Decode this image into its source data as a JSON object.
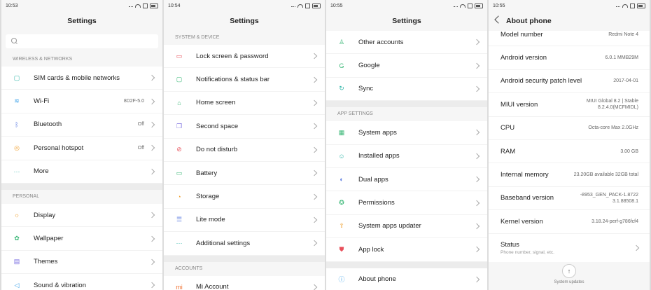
{
  "panel1": {
    "time": "10:53",
    "title": "Settings",
    "sections": [
      {
        "header": "WIRELESS & NETWORKS",
        "items": [
          {
            "label": "SIM cards & mobile networks",
            "value": "",
            "icon": "sim-icon",
            "glyph": "▢",
            "color": "#2fb5a8"
          },
          {
            "label": "Wi-Fi",
            "value": "8D2F-5.0",
            "icon": "wifi-icon",
            "glyph": "≋",
            "color": "#3aa0e8"
          },
          {
            "label": "Bluetooth",
            "value": "Off",
            "icon": "bluetooth-icon",
            "glyph": "ᛒ",
            "color": "#5b7be0"
          },
          {
            "label": "Personal hotspot",
            "value": "Off",
            "icon": "hotspot-icon",
            "glyph": "◎",
            "color": "#f0a030"
          },
          {
            "label": "More",
            "value": "",
            "icon": "more-icon",
            "glyph": "···",
            "color": "#2fb5a8"
          }
        ]
      },
      {
        "header": "PERSONAL",
        "items": [
          {
            "label": "Display",
            "value": "",
            "icon": "display-icon",
            "glyph": "☼",
            "color": "#f0a030"
          },
          {
            "label": "Wallpaper",
            "value": "",
            "icon": "wallpaper-icon",
            "glyph": "✿",
            "color": "#3cb878"
          },
          {
            "label": "Themes",
            "value": "",
            "icon": "themes-icon",
            "glyph": "▤",
            "color": "#7a6ee0"
          },
          {
            "label": "Sound & vibration",
            "value": "",
            "icon": "sound-icon",
            "glyph": "◁",
            "color": "#3aa0e8"
          }
        ]
      }
    ]
  },
  "panel2": {
    "time": "10:54",
    "title": "Settings",
    "sections": [
      {
        "header": "SYSTEM & DEVICE",
        "items": [
          {
            "label": "Lock screen & password",
            "value": "",
            "icon": "lock-icon",
            "glyph": "▭",
            "color": "#e8505b"
          },
          {
            "label": "Notifications & status bar",
            "value": "",
            "icon": "notifications-icon",
            "glyph": "▢",
            "color": "#3cb878"
          },
          {
            "label": "Home screen",
            "value": "",
            "icon": "home-icon",
            "glyph": "⌂",
            "color": "#3cb878"
          },
          {
            "label": "Second space",
            "value": "",
            "icon": "second-space-icon",
            "glyph": "❐",
            "color": "#7a6ee0"
          },
          {
            "label": "Do not disturb",
            "value": "",
            "icon": "do-not-disturb-icon",
            "glyph": "⊘",
            "color": "#e8505b"
          },
          {
            "label": "Battery",
            "value": "",
            "icon": "battery-icon",
            "glyph": "▭",
            "color": "#3cb878"
          },
          {
            "label": "Storage",
            "value": "",
            "icon": "storage-icon",
            "glyph": "◔",
            "color": "#f0a030"
          },
          {
            "label": "Lite mode",
            "value": "",
            "icon": "lite-mode-icon",
            "glyph": "☰",
            "color": "#5b7be0"
          },
          {
            "label": "Additional settings",
            "value": "",
            "icon": "additional-settings-icon",
            "glyph": "···",
            "color": "#2fb5a8"
          }
        ]
      },
      {
        "header": "ACCOUNTS",
        "items": [
          {
            "label": "Mi Account",
            "value": "",
            "icon": "mi-account-icon",
            "glyph": "mi",
            "color": "#f07030"
          }
        ]
      }
    ]
  },
  "panel3": {
    "time": "10:55",
    "title": "Settings",
    "sections": [
      {
        "header": "",
        "items": [
          {
            "label": "Other accounts",
            "value": "",
            "icon": "accounts-icon",
            "glyph": "♙",
            "color": "#3cb878"
          },
          {
            "label": "Google",
            "value": "",
            "icon": "google-icon",
            "glyph": "G",
            "color": "#3cb878"
          },
          {
            "label": "Sync",
            "value": "",
            "icon": "sync-icon",
            "glyph": "↻",
            "color": "#2fb5a8"
          }
        ]
      },
      {
        "header": "APP SETTINGS",
        "items": [
          {
            "label": "System apps",
            "value": "",
            "icon": "system-apps-icon",
            "glyph": "▦",
            "color": "#3cb878"
          },
          {
            "label": "Installed apps",
            "value": "",
            "icon": "installed-apps-icon",
            "glyph": "☺",
            "color": "#2fb5a8"
          },
          {
            "label": "Dual apps",
            "value": "",
            "icon": "dual-apps-icon",
            "glyph": "◐",
            "color": "#5b7be0"
          },
          {
            "label": "Permissions",
            "value": "",
            "icon": "permissions-icon",
            "glyph": "✪",
            "color": "#3cb878"
          },
          {
            "label": "System apps updater",
            "value": "",
            "icon": "updater-icon",
            "glyph": "⇪",
            "color": "#f0a030"
          },
          {
            "label": "App lock",
            "value": "",
            "icon": "app-lock-icon",
            "glyph": "⛊",
            "color": "#e8505b"
          }
        ]
      },
      {
        "header": "",
        "items": [
          {
            "label": "About phone",
            "value": "",
            "icon": "info-icon",
            "glyph": "ⓘ",
            "color": "#3aa0e8"
          }
        ]
      }
    ]
  },
  "panel4": {
    "time": "10:55",
    "title": "About phone",
    "rows": [
      {
        "label": "Model number",
        "value": "Redmi Note 4"
      },
      {
        "label": "Android version",
        "value": "6.0.1 MMB29M"
      },
      {
        "label": "Android security patch level",
        "value": "2017-04-01"
      },
      {
        "label": "MIUI version",
        "value": "MIUI Global 8.2 | Stable 8.2.4.0(MCFMIDL)"
      },
      {
        "label": "CPU",
        "value": "Octa-core Max 2.0GHz"
      },
      {
        "label": "RAM",
        "value": "3.00 GB"
      },
      {
        "label": "Internal memory",
        "value": "23.20GB available 32GB total"
      },
      {
        "label": "Baseband version",
        "value": "-8953_GEN_PACK-1.8722 3.1.88508.1"
      },
      {
        "label": "Kernel version",
        "value": "3.18.24-perf-g786fcf4"
      }
    ],
    "status_label": "Status",
    "status_sub": "Phone number, signal, etc.",
    "updates_label": "System updates"
  }
}
